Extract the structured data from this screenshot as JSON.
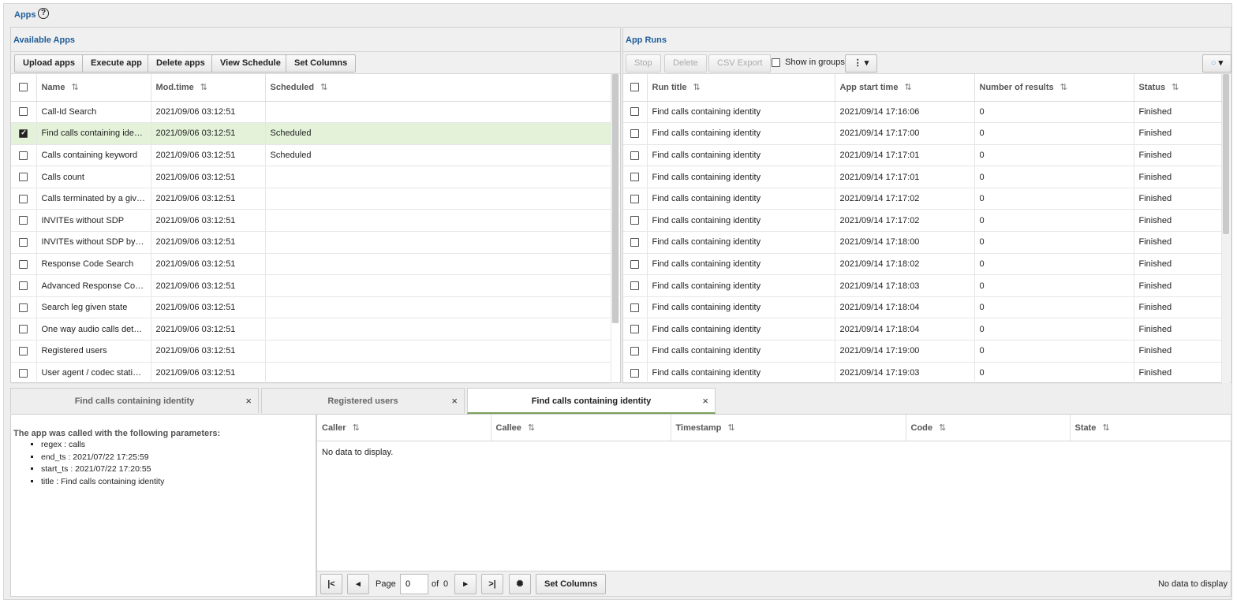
{
  "app": {
    "title": "Apps",
    "help_icon": "question-circle-icon"
  },
  "available": {
    "title": "Available Apps",
    "buttons": {
      "upload": "Upload apps",
      "execute": "Execute app",
      "delete": "Delete apps",
      "schedule": "View Schedule",
      "set_columns": "Set Columns"
    },
    "columns": {
      "name": "Name",
      "modtime": "Mod.time",
      "scheduled": "Scheduled"
    },
    "rows": [
      {
        "name": "Call-Id Search",
        "modtime": "2021/09/06 03:12:51",
        "scheduled": "",
        "checked": false
      },
      {
        "name": "Find calls containing identity",
        "modtime": "2021/09/06 03:12:51",
        "scheduled": "Scheduled",
        "checked": true
      },
      {
        "name": "Calls containing keyword",
        "modtime": "2021/09/06 03:12:51",
        "scheduled": "Scheduled",
        "checked": false
      },
      {
        "name": "Calls count",
        "modtime": "2021/09/06 03:12:51",
        "scheduled": "",
        "checked": false
      },
      {
        "name": "Calls terminated by a given response code",
        "modtime": "2021/09/06 03:12:51",
        "scheduled": "",
        "checked": false
      },
      {
        "name": "INVITEs without SDP",
        "modtime": "2021/09/06 03:12:51",
        "scheduled": "",
        "checked": false
      },
      {
        "name": "INVITEs without SDP by IP",
        "modtime": "2021/09/06 03:12:51",
        "scheduled": "",
        "checked": false
      },
      {
        "name": "Response Code Search",
        "modtime": "2021/09/06 03:12:51",
        "scheduled": "",
        "checked": false
      },
      {
        "name": "Advanced Response Code Search",
        "modtime": "2021/09/06 03:12:51",
        "scheduled": "",
        "checked": false
      },
      {
        "name": "Search leg given state",
        "modtime": "2021/09/06 03:12:51",
        "scheduled": "",
        "checked": false
      },
      {
        "name": "One way audio calls detection",
        "modtime": "2021/09/06 03:12:51",
        "scheduled": "",
        "checked": false
      },
      {
        "name": "Registered users",
        "modtime": "2021/09/06 03:12:51",
        "scheduled": "",
        "checked": false
      },
      {
        "name": "User agent / codec statistics",
        "modtime": "2021/09/06 03:12:51",
        "scheduled": "",
        "checked": false
      }
    ]
  },
  "runs": {
    "title": "App Runs",
    "buttons": {
      "stop": "Stop",
      "delete": "Delete",
      "csv": "CSV Export",
      "show_groups": "Show in groups",
      "more_icon": "kebab-menu-icon",
      "filter_icon": "circle-dropdown-icon"
    },
    "columns": {
      "run_title": "Run title",
      "start_time": "App start time",
      "results": "Number of results",
      "status": "Status"
    },
    "rows": [
      {
        "title": "Find calls containing identity",
        "start": "2021/09/14 17:16:06",
        "results": "0",
        "status": "Finished"
      },
      {
        "title": "Find calls containing identity",
        "start": "2021/09/14 17:17:00",
        "results": "0",
        "status": "Finished"
      },
      {
        "title": "Find calls containing identity",
        "start": "2021/09/14 17:17:01",
        "results": "0",
        "status": "Finished"
      },
      {
        "title": "Find calls containing identity",
        "start": "2021/09/14 17:17:01",
        "results": "0",
        "status": "Finished"
      },
      {
        "title": "Find calls containing identity",
        "start": "2021/09/14 17:17:02",
        "results": "0",
        "status": "Finished"
      },
      {
        "title": "Find calls containing identity",
        "start": "2021/09/14 17:17:02",
        "results": "0",
        "status": "Finished"
      },
      {
        "title": "Find calls containing identity",
        "start": "2021/09/14 17:18:00",
        "results": "0",
        "status": "Finished"
      },
      {
        "title": "Find calls containing identity",
        "start": "2021/09/14 17:18:02",
        "results": "0",
        "status": "Finished"
      },
      {
        "title": "Find calls containing identity",
        "start": "2021/09/14 17:18:03",
        "results": "0",
        "status": "Finished"
      },
      {
        "title": "Find calls containing identity",
        "start": "2021/09/14 17:18:04",
        "results": "0",
        "status": "Finished"
      },
      {
        "title": "Find calls containing identity",
        "start": "2021/09/14 17:18:04",
        "results": "0",
        "status": "Finished"
      },
      {
        "title": "Find calls containing identity",
        "start": "2021/09/14 17:19:00",
        "results": "0",
        "status": "Finished"
      },
      {
        "title": "Find calls containing identity",
        "start": "2021/09/14 17:19:03",
        "results": "0",
        "status": "Finished"
      }
    ]
  },
  "tabs": [
    {
      "label": "Find calls containing identity",
      "active": false
    },
    {
      "label": "Registered users",
      "active": false
    },
    {
      "label": "Find calls containing identity",
      "active": true
    }
  ],
  "params": {
    "title": "The app was called with the following parameters:",
    "items": [
      "regex : calls",
      "end_ts : 2021/07/22 17:25:59",
      "start_ts : 2021/07/22 17:20:55",
      "title : Find calls containing identity"
    ]
  },
  "results": {
    "columns": {
      "caller": "Caller",
      "callee": "Callee",
      "timestamp": "Timestamp",
      "code": "Code",
      "state": "State"
    },
    "empty_text": "No data to display."
  },
  "pager": {
    "page_label": "Page",
    "page_value": "0",
    "of_label": "of",
    "total_pages": "0",
    "set_columns": "Set Columns",
    "status": "No data to display"
  }
}
